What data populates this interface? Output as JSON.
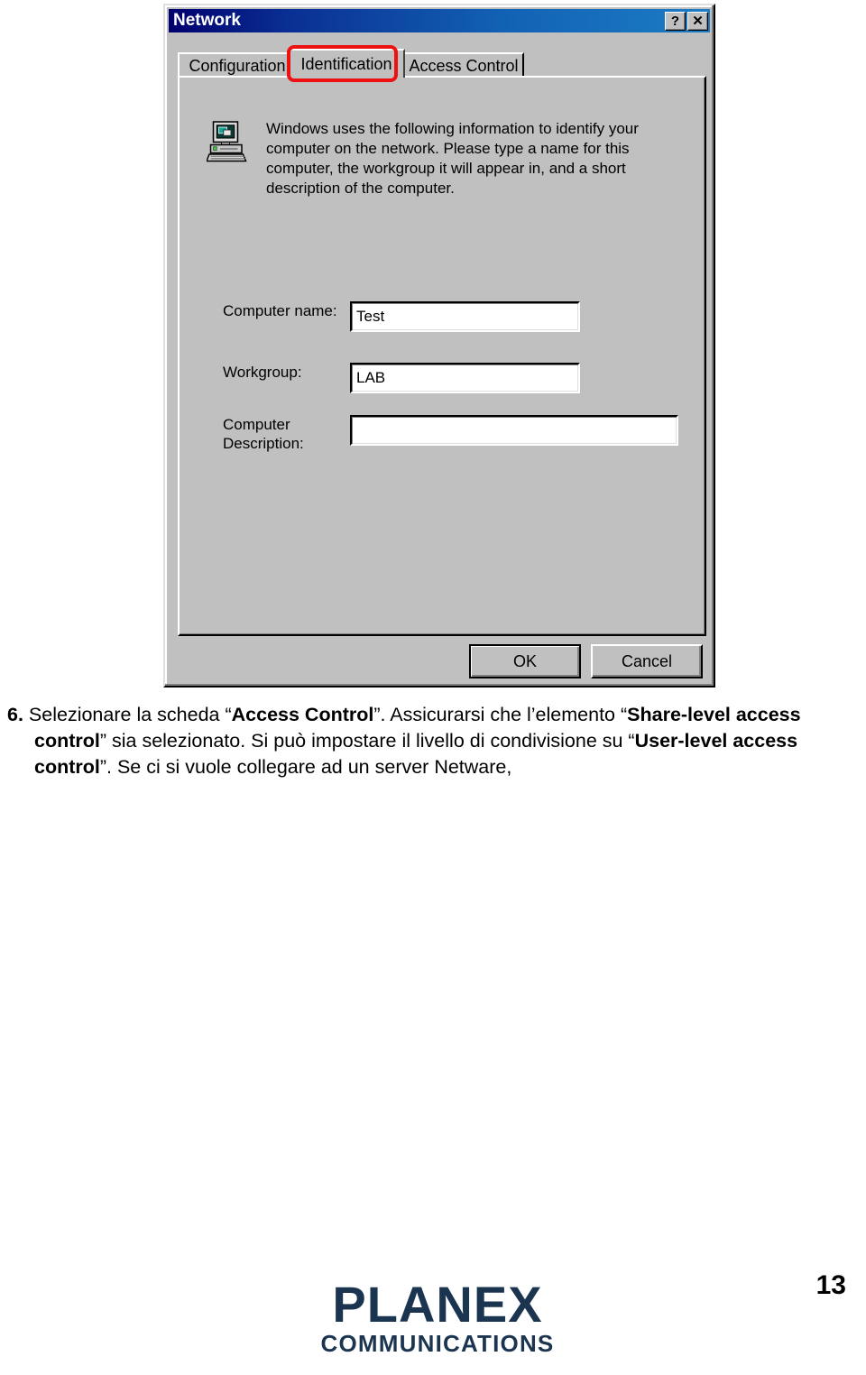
{
  "dialog": {
    "title": "Network",
    "titlebar_buttons": [
      {
        "name": "help-button",
        "glyph": "?"
      },
      {
        "name": "close-button",
        "glyph": "✕"
      }
    ],
    "tabs": [
      {
        "label": "Configuration",
        "active": false
      },
      {
        "label": "Identification",
        "active": true
      },
      {
        "label": "Access Control",
        "active": false
      }
    ],
    "highlighted_tab": "Identification",
    "highlight_color": "#ee1111",
    "info_text": "Windows uses the following information to identify your computer on the network.  Please type a name for this computer, the workgroup it will appear in, and a short description of the computer.",
    "icon_name": "computer-network-icon",
    "fields": [
      {
        "label": "Computer name:",
        "value": "Test",
        "placeholder": ""
      },
      {
        "label": "Workgroup:",
        "value": "LAB",
        "placeholder": ""
      },
      {
        "label": "Computer Description:",
        "value": "",
        "placeholder": ""
      }
    ],
    "buttons": [
      {
        "label": "OK",
        "default": true
      },
      {
        "label": "Cancel",
        "default": false
      }
    ]
  },
  "document": {
    "step_number": "6.",
    "line1_a": "Selezionare la scheda “",
    "line1_b": "Access Control",
    "line1_c": "”. Assicurarsi che l’elemento “",
    "line1_d": "Share-level access control",
    "line1_e": "” sia selezionato. Si può impostare il livello di condivisione su “",
    "line1_f": "User-level access control",
    "line1_g": "”. Se ci si vuole collegare ad un server Netware,",
    "page_number": "13"
  },
  "footer": {
    "logo_main": "PLANEX",
    "logo_sub": "COMMUNICATIONS",
    "logo_color": "#1b3550"
  }
}
